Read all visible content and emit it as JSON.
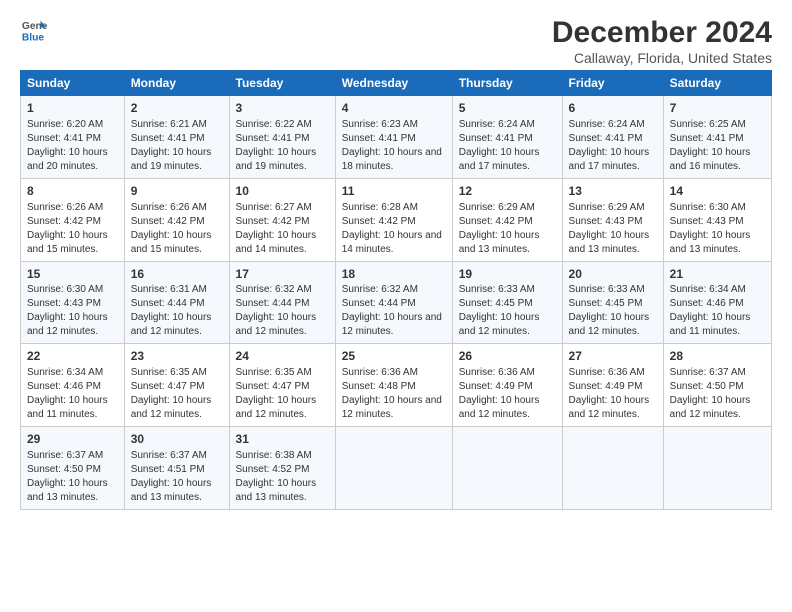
{
  "header": {
    "logo_line1": "General",
    "logo_line2": "Blue",
    "title": "December 2024",
    "subtitle": "Callaway, Florida, United States"
  },
  "days_of_week": [
    "Sunday",
    "Monday",
    "Tuesday",
    "Wednesday",
    "Thursday",
    "Friday",
    "Saturday"
  ],
  "weeks": [
    [
      {
        "day": "1",
        "sunrise": "Sunrise: 6:20 AM",
        "sunset": "Sunset: 4:41 PM",
        "daylight": "Daylight: 10 hours and 20 minutes."
      },
      {
        "day": "2",
        "sunrise": "Sunrise: 6:21 AM",
        "sunset": "Sunset: 4:41 PM",
        "daylight": "Daylight: 10 hours and 19 minutes."
      },
      {
        "day": "3",
        "sunrise": "Sunrise: 6:22 AM",
        "sunset": "Sunset: 4:41 PM",
        "daylight": "Daylight: 10 hours and 19 minutes."
      },
      {
        "day": "4",
        "sunrise": "Sunrise: 6:23 AM",
        "sunset": "Sunset: 4:41 PM",
        "daylight": "Daylight: 10 hours and 18 minutes."
      },
      {
        "day": "5",
        "sunrise": "Sunrise: 6:24 AM",
        "sunset": "Sunset: 4:41 PM",
        "daylight": "Daylight: 10 hours and 17 minutes."
      },
      {
        "day": "6",
        "sunrise": "Sunrise: 6:24 AM",
        "sunset": "Sunset: 4:41 PM",
        "daylight": "Daylight: 10 hours and 17 minutes."
      },
      {
        "day": "7",
        "sunrise": "Sunrise: 6:25 AM",
        "sunset": "Sunset: 4:41 PM",
        "daylight": "Daylight: 10 hours and 16 minutes."
      }
    ],
    [
      {
        "day": "8",
        "sunrise": "Sunrise: 6:26 AM",
        "sunset": "Sunset: 4:42 PM",
        "daylight": "Daylight: 10 hours and 15 minutes."
      },
      {
        "day": "9",
        "sunrise": "Sunrise: 6:26 AM",
        "sunset": "Sunset: 4:42 PM",
        "daylight": "Daylight: 10 hours and 15 minutes."
      },
      {
        "day": "10",
        "sunrise": "Sunrise: 6:27 AM",
        "sunset": "Sunset: 4:42 PM",
        "daylight": "Daylight: 10 hours and 14 minutes."
      },
      {
        "day": "11",
        "sunrise": "Sunrise: 6:28 AM",
        "sunset": "Sunset: 4:42 PM",
        "daylight": "Daylight: 10 hours and 14 minutes."
      },
      {
        "day": "12",
        "sunrise": "Sunrise: 6:29 AM",
        "sunset": "Sunset: 4:42 PM",
        "daylight": "Daylight: 10 hours and 13 minutes."
      },
      {
        "day": "13",
        "sunrise": "Sunrise: 6:29 AM",
        "sunset": "Sunset: 4:43 PM",
        "daylight": "Daylight: 10 hours and 13 minutes."
      },
      {
        "day": "14",
        "sunrise": "Sunrise: 6:30 AM",
        "sunset": "Sunset: 4:43 PM",
        "daylight": "Daylight: 10 hours and 13 minutes."
      }
    ],
    [
      {
        "day": "15",
        "sunrise": "Sunrise: 6:30 AM",
        "sunset": "Sunset: 4:43 PM",
        "daylight": "Daylight: 10 hours and 12 minutes."
      },
      {
        "day": "16",
        "sunrise": "Sunrise: 6:31 AM",
        "sunset": "Sunset: 4:44 PM",
        "daylight": "Daylight: 10 hours and 12 minutes."
      },
      {
        "day": "17",
        "sunrise": "Sunrise: 6:32 AM",
        "sunset": "Sunset: 4:44 PM",
        "daylight": "Daylight: 10 hours and 12 minutes."
      },
      {
        "day": "18",
        "sunrise": "Sunrise: 6:32 AM",
        "sunset": "Sunset: 4:44 PM",
        "daylight": "Daylight: 10 hours and 12 minutes."
      },
      {
        "day": "19",
        "sunrise": "Sunrise: 6:33 AM",
        "sunset": "Sunset: 4:45 PM",
        "daylight": "Daylight: 10 hours and 12 minutes."
      },
      {
        "day": "20",
        "sunrise": "Sunrise: 6:33 AM",
        "sunset": "Sunset: 4:45 PM",
        "daylight": "Daylight: 10 hours and 12 minutes."
      },
      {
        "day": "21",
        "sunrise": "Sunrise: 6:34 AM",
        "sunset": "Sunset: 4:46 PM",
        "daylight": "Daylight: 10 hours and 11 minutes."
      }
    ],
    [
      {
        "day": "22",
        "sunrise": "Sunrise: 6:34 AM",
        "sunset": "Sunset: 4:46 PM",
        "daylight": "Daylight: 10 hours and 11 minutes."
      },
      {
        "day": "23",
        "sunrise": "Sunrise: 6:35 AM",
        "sunset": "Sunset: 4:47 PM",
        "daylight": "Daylight: 10 hours and 12 minutes."
      },
      {
        "day": "24",
        "sunrise": "Sunrise: 6:35 AM",
        "sunset": "Sunset: 4:47 PM",
        "daylight": "Daylight: 10 hours and 12 minutes."
      },
      {
        "day": "25",
        "sunrise": "Sunrise: 6:36 AM",
        "sunset": "Sunset: 4:48 PM",
        "daylight": "Daylight: 10 hours and 12 minutes."
      },
      {
        "day": "26",
        "sunrise": "Sunrise: 6:36 AM",
        "sunset": "Sunset: 4:49 PM",
        "daylight": "Daylight: 10 hours and 12 minutes."
      },
      {
        "day": "27",
        "sunrise": "Sunrise: 6:36 AM",
        "sunset": "Sunset: 4:49 PM",
        "daylight": "Daylight: 10 hours and 12 minutes."
      },
      {
        "day": "28",
        "sunrise": "Sunrise: 6:37 AM",
        "sunset": "Sunset: 4:50 PM",
        "daylight": "Daylight: 10 hours and 12 minutes."
      }
    ],
    [
      {
        "day": "29",
        "sunrise": "Sunrise: 6:37 AM",
        "sunset": "Sunset: 4:50 PM",
        "daylight": "Daylight: 10 hours and 13 minutes."
      },
      {
        "day": "30",
        "sunrise": "Sunrise: 6:37 AM",
        "sunset": "Sunset: 4:51 PM",
        "daylight": "Daylight: 10 hours and 13 minutes."
      },
      {
        "day": "31",
        "sunrise": "Sunrise: 6:38 AM",
        "sunset": "Sunset: 4:52 PM",
        "daylight": "Daylight: 10 hours and 13 minutes."
      },
      null,
      null,
      null,
      null
    ]
  ]
}
